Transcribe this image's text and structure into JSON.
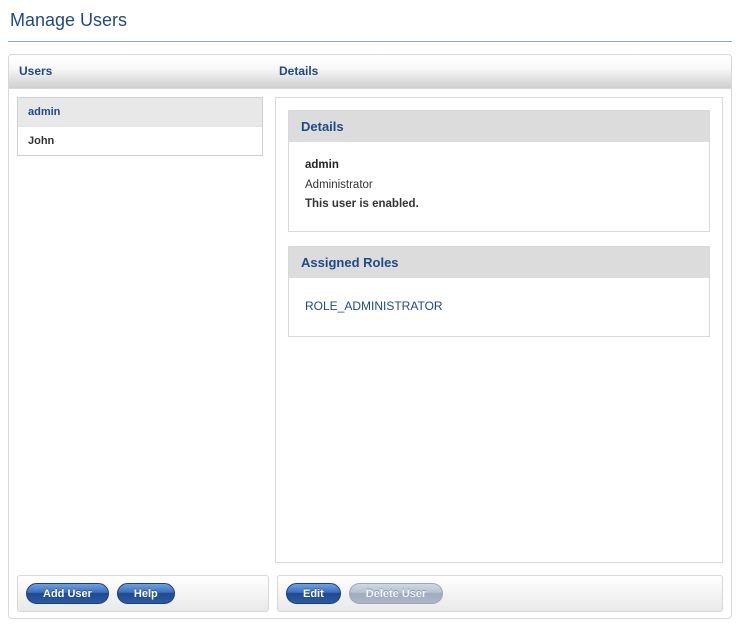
{
  "page": {
    "title": "Manage Users"
  },
  "columns": {
    "users_heading": "Users",
    "details_heading": "Details"
  },
  "users": {
    "items": [
      {
        "label": "admin",
        "selected": true
      },
      {
        "label": "John",
        "selected": false
      }
    ]
  },
  "details": {
    "card_title": "Details",
    "username": "admin",
    "display_name": "Administrator",
    "status_text": "This user is enabled."
  },
  "roles": {
    "card_title": "Assigned Roles",
    "items": [
      {
        "label": "ROLE_ADMINISTRATOR"
      }
    ]
  },
  "buttons": {
    "add_user": "Add User",
    "help": "Help",
    "edit": "Edit",
    "delete_user": "Delete User"
  }
}
